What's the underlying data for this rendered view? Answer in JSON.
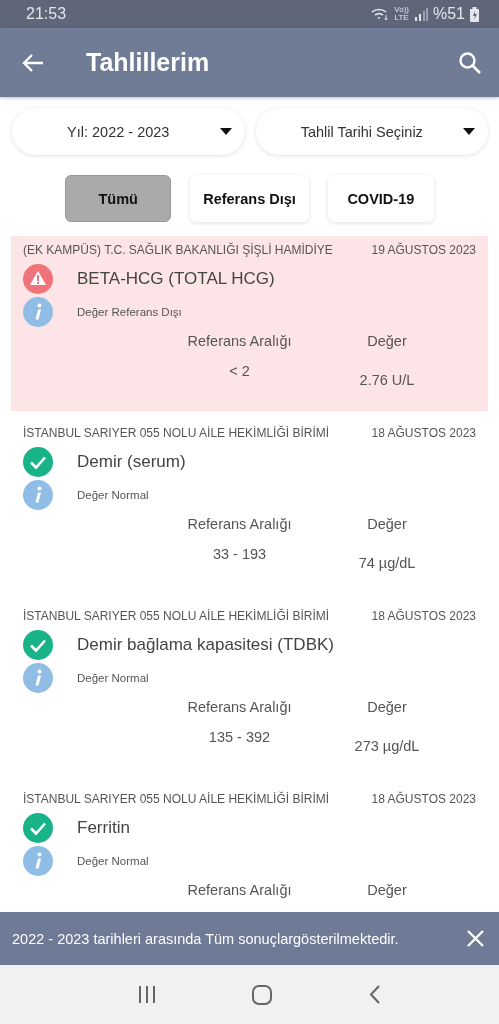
{
  "status_bar": {
    "time": "21:53",
    "volte": "Vo))",
    "network": "LTE",
    "battery": "%51"
  },
  "app_bar": {
    "title": "Tahlillerim"
  },
  "filters": [
    {
      "label": "Yıl: 2022 - 2023"
    },
    {
      "label": "Tahlil Tarihi Seçiniz"
    }
  ],
  "chips": [
    {
      "label": "Tümü",
      "selected": true
    },
    {
      "label": "Referans Dışı",
      "selected": false
    },
    {
      "label": "COVID-19",
      "selected": false
    }
  ],
  "results": [
    {
      "institution": "(EK KAMPÜS) T.C. SAĞLIK BAKANLIĞI ŞİŞLİ HAMİDİYE",
      "date": "19 AĞUSTOS 2023",
      "test": "BETA-HCG (TOTAL HCG)",
      "kind": "out_of_range",
      "note": "Değer Referans Dışı",
      "range_label": "Referans Aralığı",
      "value_label": "Değer",
      "range": "< 2",
      "value": "2.76 U/L"
    },
    {
      "institution": "İSTANBUL SARIYER 055 NOLU AİLE HEKİMLİĞİ BİRİMİ",
      "date": "18 AĞUSTOS 2023",
      "test": "Demir (serum)",
      "kind": "normal",
      "note": "Değer Normal",
      "range_label": "Referans Aralığı",
      "value_label": "Değer",
      "range": "33 - 193",
      "value": "74 µg/dL"
    },
    {
      "institution": "İSTANBUL SARIYER 055 NOLU AİLE HEKİMLİĞİ BİRİMİ",
      "date": "18 AĞUSTOS 2023",
      "test": "Demir bağlama kapasitesi (TDBK)",
      "kind": "normal",
      "note": "Değer Normal",
      "range_label": "Referans Aralığı",
      "value_label": "Değer",
      "range": "135 - 392",
      "value": "273 µg/dL"
    },
    {
      "institution": "İSTANBUL SARIYER 055 NOLU AİLE HEKİMLİĞİ BİRİMİ",
      "date": "18 AĞUSTOS 2023",
      "test": "Ferritin",
      "kind": "normal",
      "note": "Değer Normal",
      "range_label": "Referans Aralığı",
      "value_label": "Değer"
    }
  ],
  "snackbar": {
    "message": "2022 - 2023 tarihleri arasında Tüm sonuçlargösterilmektedir."
  }
}
